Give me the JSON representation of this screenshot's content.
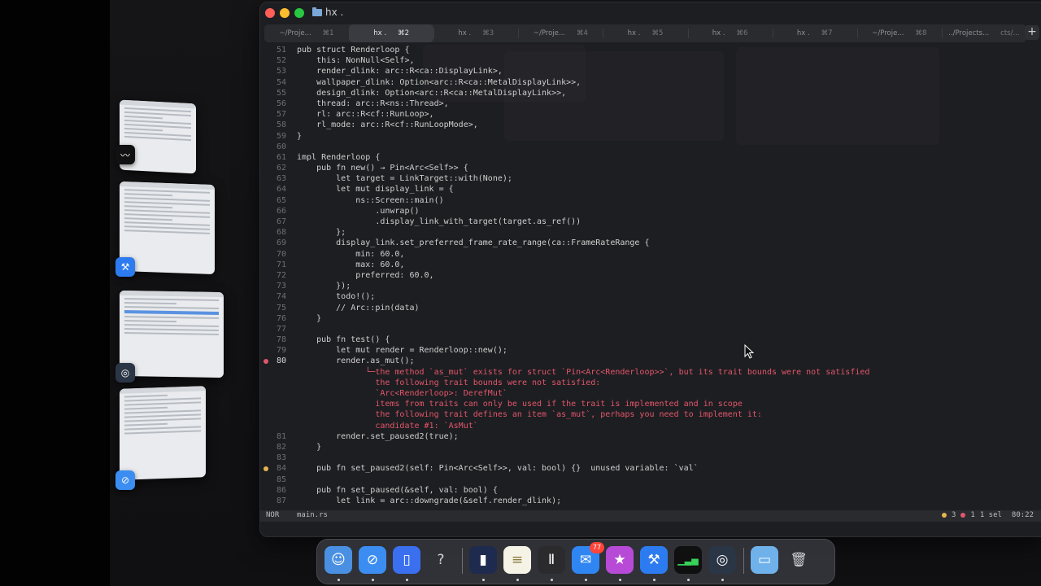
{
  "window": {
    "title": "hx ."
  },
  "tabs": [
    {
      "label": "~/Proje...",
      "kbd": "⌘1"
    },
    {
      "label": "hx .",
      "kbd": "⌘2"
    },
    {
      "label": "hx .",
      "kbd": "⌘3"
    },
    {
      "label": "~/Proje...",
      "kbd": "⌘4"
    },
    {
      "label": "hx .",
      "kbd": "⌘5"
    },
    {
      "label": "hx .",
      "kbd": "⌘6"
    },
    {
      "label": "hx .",
      "kbd": "⌘7"
    },
    {
      "label": "~/Proje...",
      "kbd": "⌘8"
    },
    {
      "label": "../Projects...",
      "kbd": "cts/..."
    }
  ],
  "new_tab_label": "+",
  "editor": {
    "lines": [
      {
        "n": "51",
        "t": "pub struct Renderloop {"
      },
      {
        "n": "52",
        "t": "    this: NonNull<Self>,"
      },
      {
        "n": "53",
        "t": "    render_dlink: arc::R<ca::DisplayLink>,"
      },
      {
        "n": "54",
        "t": "    wallpaper_dlink: Option<arc::R<ca::MetalDisplayLink>>,"
      },
      {
        "n": "55",
        "t": "    design_dlink: Option<arc::R<ca::MetalDisplayLink>>,"
      },
      {
        "n": "56",
        "t": "    thread: arc::R<ns::Thread>,"
      },
      {
        "n": "57",
        "t": "    rl: arc::R<cf::RunLoop>,"
      },
      {
        "n": "58",
        "t": "    rl_mode: arc::R<cf::RunLoopMode>,"
      },
      {
        "n": "59",
        "t": "}"
      },
      {
        "n": "60",
        "t": ""
      },
      {
        "n": "61",
        "t": "impl Renderloop {"
      },
      {
        "n": "62",
        "t": "    pub fn new() → Pin<Arc<Self>> {"
      },
      {
        "n": "63",
        "t": "        let target = LinkTarget::with(None);"
      },
      {
        "n": "64",
        "t": "        let mut display_link = {"
      },
      {
        "n": "65",
        "t": "            ns::Screen::main()"
      },
      {
        "n": "66",
        "t": "                .unwrap()"
      },
      {
        "n": "67",
        "t": "                .display_link_with_target(target.as_ref())"
      },
      {
        "n": "68",
        "t": "        };"
      },
      {
        "n": "69",
        "t": "        display_link.set_preferred_frame_rate_range(ca::FrameRateRange {"
      },
      {
        "n": "70",
        "t": "            min: 60.0,"
      },
      {
        "n": "71",
        "t": "            max: 60.0,"
      },
      {
        "n": "72",
        "t": "            preferred: 60.0,"
      },
      {
        "n": "73",
        "t": "        });"
      },
      {
        "n": "74",
        "t": "        todo!();"
      },
      {
        "n": "75",
        "t": "        // Arc::pin(data)"
      },
      {
        "n": "76",
        "t": "    }"
      },
      {
        "n": "77",
        "t": ""
      },
      {
        "n": "78",
        "t": "    pub fn test() {"
      },
      {
        "n": "79",
        "t": "        let mut render = Renderloop::new();"
      },
      {
        "n": "80",
        "t": "        render.as_mut();",
        "marker": "err",
        "current": true
      },
      {
        "n": "",
        "t": "              └─the method `as_mut` exists for struct `Pin<Arc<Renderloop>>`, but its trait bounds were not satisfied",
        "diag": true
      },
      {
        "n": "",
        "t": "                the following trait bounds were not satisfied:",
        "diag": true
      },
      {
        "n": "",
        "t": "                `Arc<Renderloop>: DerefMut`",
        "diag": true
      },
      {
        "n": "",
        "t": "                items from traits can only be used if the trait is implemented and in scope",
        "diag": true
      },
      {
        "n": "",
        "t": "                the following trait defines an item `as_mut`, perhaps you need to implement it:",
        "diag": true
      },
      {
        "n": "",
        "t": "                candidate #1: `AsMut`",
        "diag": true
      },
      {
        "n": "81",
        "t": "        render.set_paused2(true);"
      },
      {
        "n": "82",
        "t": "    }"
      },
      {
        "n": "83",
        "t": ""
      },
      {
        "n": "84",
        "t": "    pub fn set_paused2(self: Pin<Arc<Self>>, val: bool) {}  unused variable: `val`",
        "marker": "warn"
      },
      {
        "n": "85",
        "t": ""
      },
      {
        "n": "86",
        "t": "    pub fn set_paused(&self, val: bool) {"
      },
      {
        "n": "87",
        "t": "        let link = arc::downgrade(&self.render_dlink);"
      }
    ]
  },
  "status": {
    "mode": "NOR",
    "file": "main.rs",
    "warnings": "3",
    "errors": "1",
    "selection": "1 sel",
    "position": "80:22"
  },
  "dock": {
    "items": [
      {
        "name": "finder-icon",
        "glyph": "☺",
        "bg": "#4a90e2"
      },
      {
        "name": "safari-icon",
        "glyph": "⊘",
        "bg": "#3b8df1"
      },
      {
        "name": "app-icon",
        "glyph": "▯",
        "bg": "#3a6ff0"
      },
      {
        "name": "help-icon",
        "glyph": "?",
        "bg": "transparent"
      },
      {
        "name": "simulator-icon",
        "glyph": "▮",
        "bg": "#1f2a4f"
      },
      {
        "name": "notes-icon",
        "glyph": "≡",
        "bg": "#f5f2e6"
      },
      {
        "name": "helix-icon",
        "glyph": "Ⅱ",
        "bg": "#2b2b2e"
      },
      {
        "name": "mail-icon",
        "glyph": "✉",
        "bg": "#2f86f2",
        "badge": "77"
      },
      {
        "name": "feedback-icon",
        "glyph": "★",
        "bg": "#b84ad8"
      },
      {
        "name": "xcode-icon",
        "glyph": "⚒",
        "bg": "#2d7bf0"
      },
      {
        "name": "activity-monitor-icon",
        "glyph": "▁▃▅",
        "bg": "#101010"
      },
      {
        "name": "instruments-icon",
        "glyph": "◎",
        "bg": "#2a3545"
      },
      {
        "name": "downloads-folder-icon",
        "glyph": "▭",
        "bg": "#6fb1ea"
      },
      {
        "name": "trash-icon",
        "glyph": "🗑",
        "bg": "transparent"
      }
    ]
  }
}
